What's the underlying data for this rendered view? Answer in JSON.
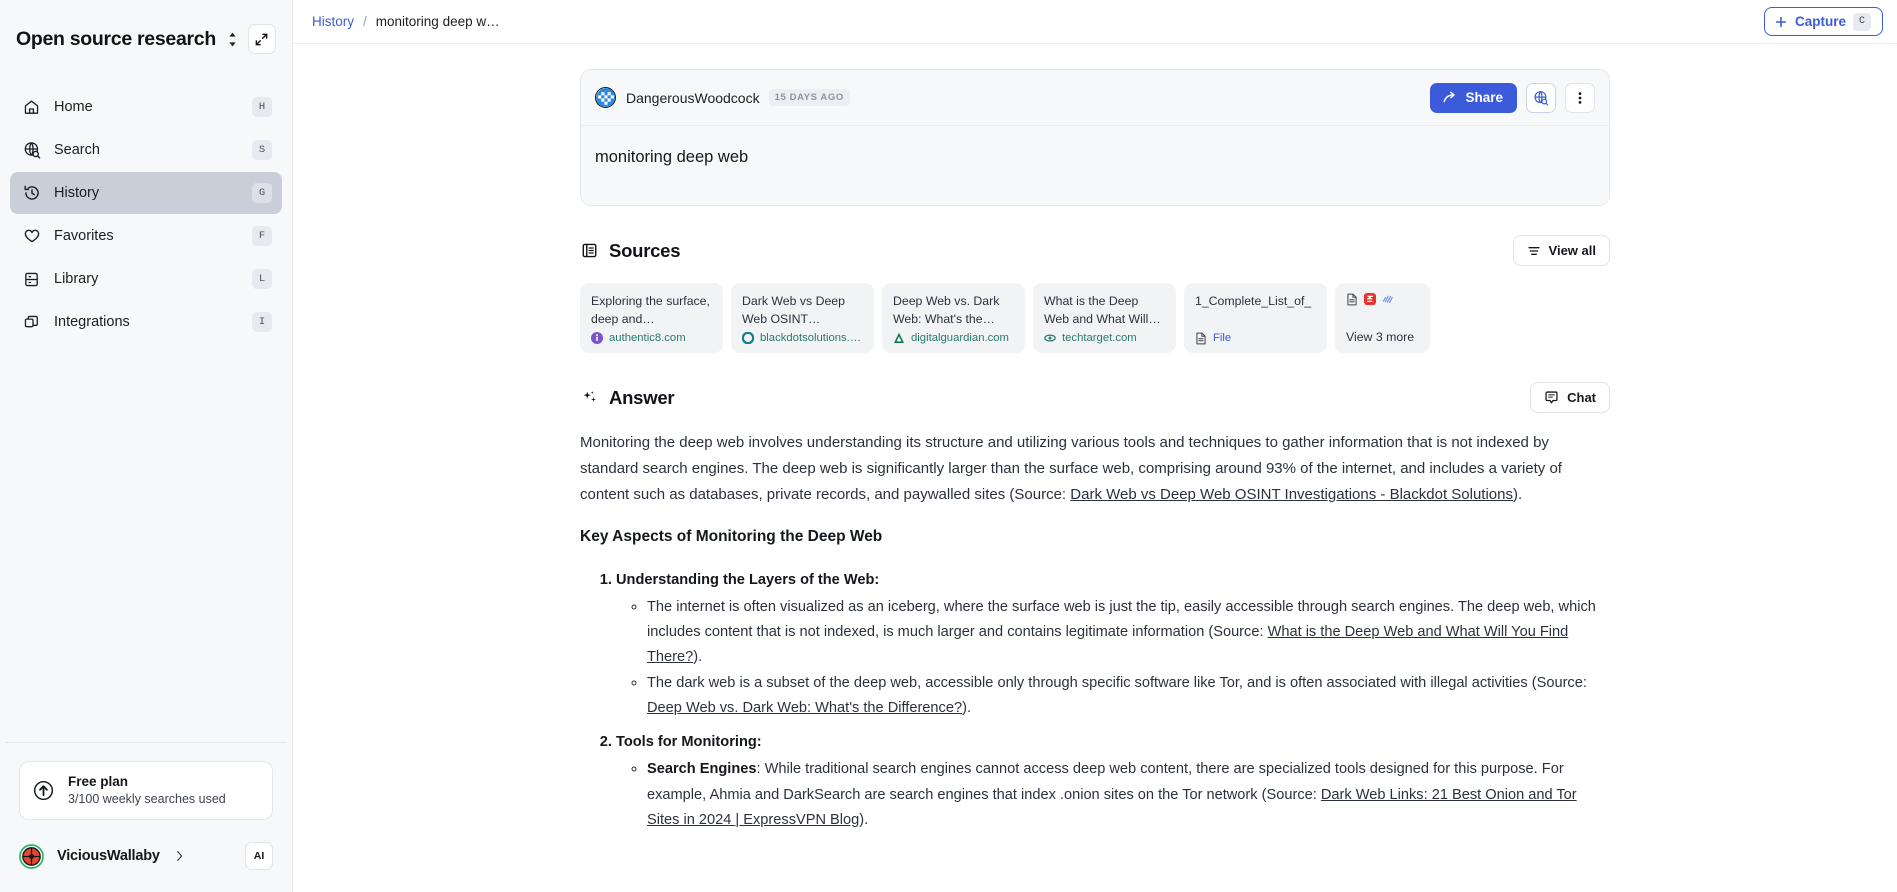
{
  "sidebar": {
    "workspace_title": "Open source research",
    "switch_icon": "chevron-updown-icon",
    "collapse_icon": "collapse-panel-icon",
    "items": [
      {
        "label": "Home",
        "key": "H",
        "icon": "home-icon",
        "active": false
      },
      {
        "label": "Search",
        "key": "S",
        "icon": "globe-search-icon",
        "active": false
      },
      {
        "label": "History",
        "key": "G",
        "icon": "clock-history-icon",
        "active": true
      },
      {
        "label": "Favorites",
        "key": "F",
        "icon": "heart-icon",
        "active": false
      },
      {
        "label": "Library",
        "key": "L",
        "icon": "book-icon",
        "active": false
      },
      {
        "label": "Integrations",
        "key": "I",
        "icon": "stack-icon",
        "active": false
      }
    ],
    "plan": {
      "icon": "upgrade-arrow-icon",
      "name": "Free plan",
      "usage": "3/100 weekly searches used"
    },
    "user": {
      "name": "ViciousWallaby",
      "chevron_icon": "chevron-right-icon",
      "ai_badge": "AI"
    }
  },
  "topbar": {
    "breadcrumb": {
      "parent": "History",
      "separator": "/",
      "current": "monitoring deep w…"
    },
    "capture": {
      "plus_icon": "plus-icon",
      "label": "Capture",
      "key": "C"
    }
  },
  "query_card": {
    "avatar": "checkered-avatar-icon",
    "username": "DangerousWoodcock",
    "age": "15 DAYS AGO",
    "share": {
      "icon": "share-arrow-icon",
      "label": "Share"
    },
    "globe_button_icon": "globe-search-icon",
    "more_button_icon": "dots-vertical-icon",
    "query": "monitoring deep web"
  },
  "sources": {
    "icon": "list-panel-icon",
    "title": "Sources",
    "view_all": {
      "icon": "filter-lines-icon",
      "label": "View all"
    },
    "cards": [
      {
        "title": "Exploring the surface, deep and…",
        "domain": "authentic8.com",
        "favicon": "authentic8-favicon",
        "kind": "web"
      },
      {
        "title": "Dark Web vs Deep Web OSINT…",
        "domain": "blackdotsolutions.c…",
        "favicon": "blackdot-favicon",
        "kind": "web"
      },
      {
        "title": "Deep Web vs. Dark Web: What's the…",
        "domain": "digitalguardian.com",
        "favicon": "digitalguardian-favicon",
        "kind": "web"
      },
      {
        "title": "What is the Deep Web and What Will…",
        "domain": "techtarget.com",
        "favicon": "techtarget-favicon",
        "kind": "web"
      },
      {
        "title": "1_Complete_List_of_",
        "domain": "File",
        "favicon": "file-icon",
        "kind": "file"
      }
    ],
    "more": {
      "icons": [
        "file-icon",
        "pdf-icon",
        "sparkle-lines-icon"
      ],
      "label": "View 3 more"
    }
  },
  "answer": {
    "icon": "sparkles-icon",
    "title": "Answer",
    "chat": {
      "icon": "chat-bubble-icon",
      "label": "Chat"
    },
    "intro_part1": "Monitoring the deep web involves understanding its structure and utilizing various tools and techniques to gather information that is not indexed by standard search engines. The deep web is significantly larger than the surface web, comprising around 93% of the internet, and includes a variety of content such as databases, private records, and paywalled sites (Source: ",
    "intro_link": "Dark Web vs Deep Web OSINT Investigations - Blackdot Solutions",
    "intro_part2": ").",
    "heading": "Key Aspects of Monitoring the Deep Web",
    "items": [
      {
        "number": "1.",
        "label": "Understanding the Layers of the Web:",
        "bullets": [
          {
            "bold": "",
            "text_part1": "The internet is often visualized as an iceberg, where the surface web is just the tip, easily accessible through search engines. The deep web, which includes content that is not indexed, is much larger and contains legitimate information (Source: ",
            "link": "What is the Deep Web and What Will You Find There?",
            "text_part2": ")."
          },
          {
            "bold": "",
            "text_part1": "The dark web is a subset of the deep web, accessible only through specific software like Tor, and is often associated with illegal activities (Source: ",
            "link": "Deep Web vs. Dark Web: What's the Difference?",
            "text_part2": ")."
          }
        ]
      },
      {
        "number": "2.",
        "label": "Tools for Monitoring:",
        "bullets": [
          {
            "bold": "Search Engines",
            "text_part1": ": While traditional search engines cannot access deep web content, there are specialized tools designed for this purpose. For example, Ahmia and DarkSearch are search engines that index .onion sites on the Tor network (Source: ",
            "link": "Dark Web Links: 21 Best Onion and Tor Sites in 2024 | ExpressVPN Blog",
            "text_part2": ")."
          }
        ]
      }
    ]
  },
  "colors": {
    "accent": "#3b5bdb",
    "sidebar_bg": "#f7f8fa",
    "active_nav": "#c9ced8",
    "source_card_bg": "#f2f3f5",
    "domain_text": "#2b7a6d",
    "body_text": "#2b313c"
  }
}
